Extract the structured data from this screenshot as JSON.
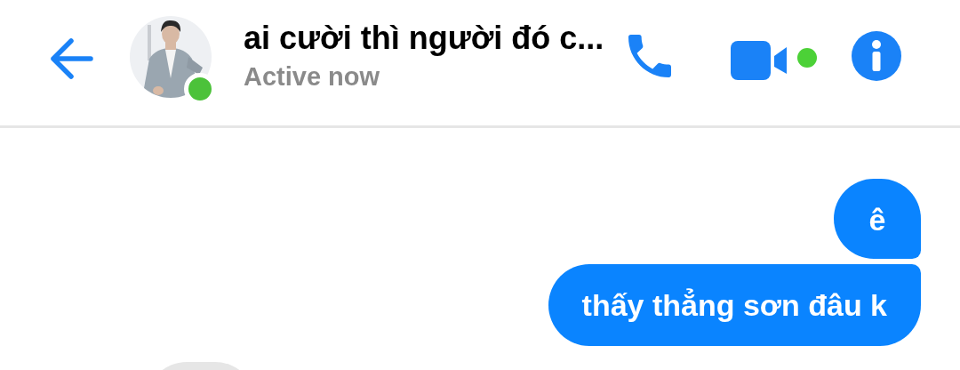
{
  "header": {
    "title": "ai cười thì người đó c...",
    "status": "Active now",
    "online": true
  },
  "messages": [
    {
      "kind": "outgoing",
      "text": "ê"
    },
    {
      "kind": "outgoing",
      "text": "thấy thẳng sơn đâu k"
    },
    {
      "kind": "incoming"
    }
  ]
}
